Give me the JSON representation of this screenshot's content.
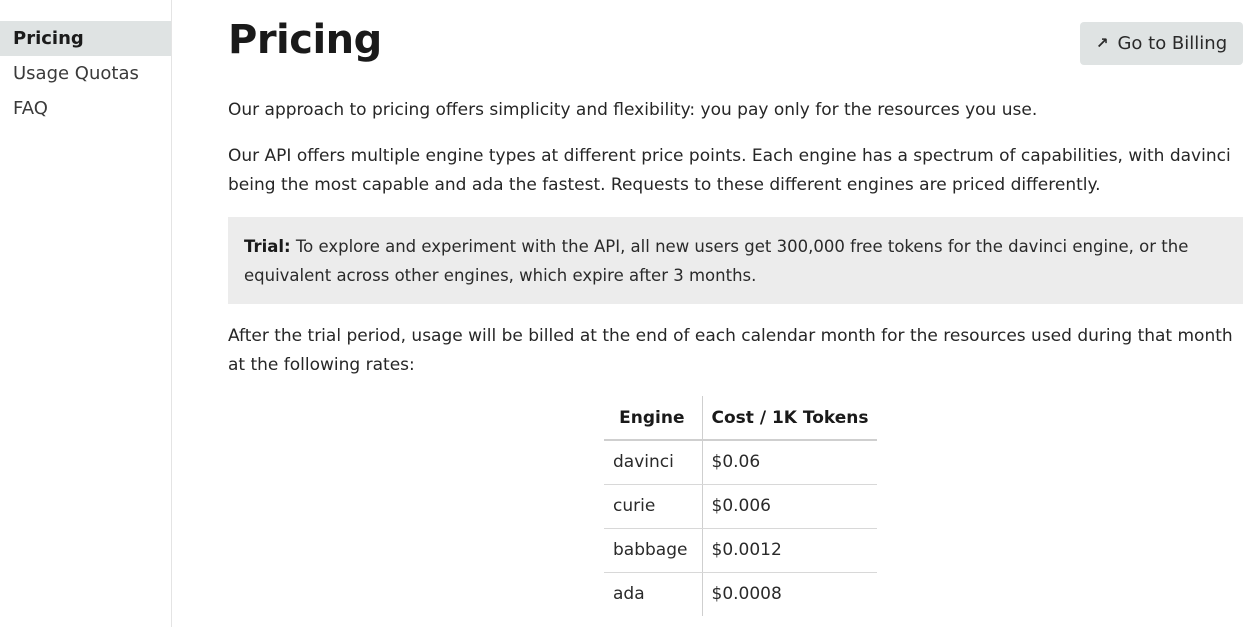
{
  "sidebar": {
    "items": [
      {
        "label": "Pricing",
        "active": true
      },
      {
        "label": "Usage Quotas",
        "active": false
      },
      {
        "label": "FAQ",
        "active": false
      }
    ]
  },
  "header": {
    "title": "Pricing",
    "billing_button": {
      "icon": "arrow-up-right-icon",
      "label": "Go to Billing"
    }
  },
  "content": {
    "intro": "Our approach to pricing offers simplicity and flexibility: you pay only for the resources you use.",
    "engines_paragraph": "Our API offers multiple engine types at different price points. Each engine has a spectrum of capabilities, with davinci being the most capable and ada the fastest. Requests to these different engines are priced differently.",
    "trial": {
      "label": "Trial:",
      "text": "To explore and experiment with the API, all new users get 300,000 free tokens for the davinci engine, or the equivalent across other engines, which expire after 3 months."
    },
    "billing_paragraph": "After the trial period, usage will be billed at the end of each calendar month for the resources used during that month at the following rates:"
  },
  "pricing_table": {
    "columns": [
      "Engine",
      "Cost / 1K Tokens"
    ],
    "rows": [
      [
        "davinci",
        "$0.06"
      ],
      [
        "curie",
        "$0.006"
      ],
      [
        "babbage",
        "$0.0012"
      ],
      [
        "ada",
        "$0.0008"
      ]
    ]
  },
  "colors": {
    "sidebar_active_bg": "#dfe3e3",
    "button_bg": "#dfe3e3",
    "callout_bg": "#ececec",
    "text": "#262626"
  }
}
